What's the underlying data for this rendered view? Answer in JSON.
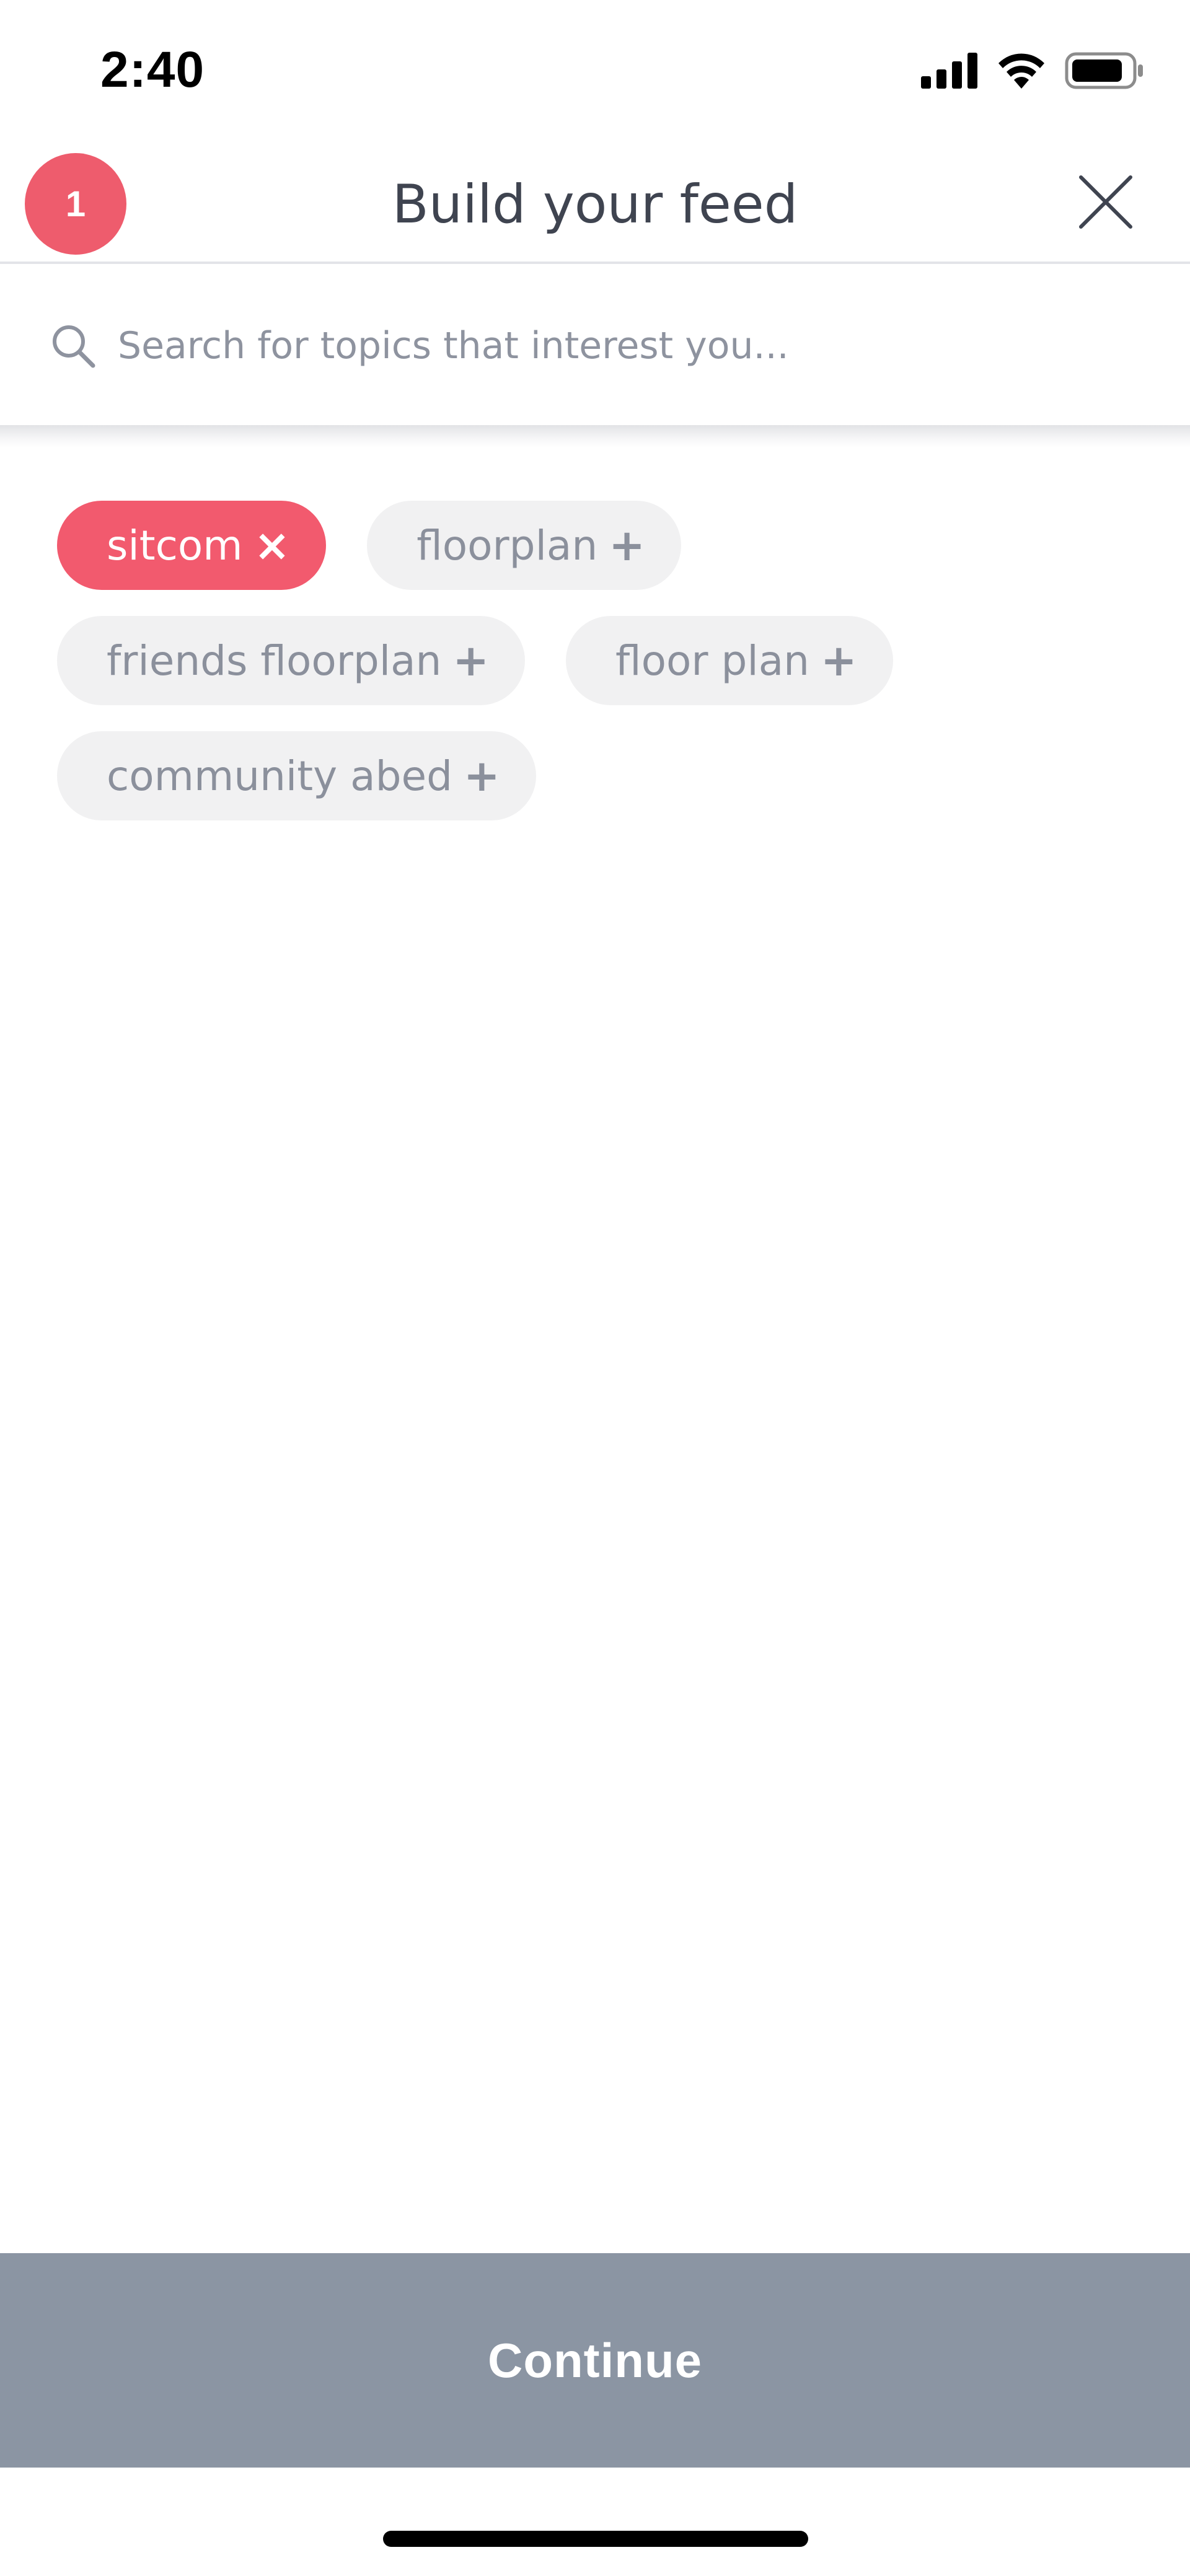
{
  "status_bar": {
    "time": "2:40",
    "icons": [
      "cellular-signal-icon",
      "wifi-icon",
      "battery-icon"
    ]
  },
  "header": {
    "step_badge": "1",
    "title": "Build your feed",
    "close_icon": "close-icon"
  },
  "search": {
    "placeholder": "Search for topics that interest you...",
    "icon": "search-icon"
  },
  "topics": [
    {
      "label": "sitcom",
      "mark": "×",
      "selected": true
    },
    {
      "label": "floorplan",
      "mark": "+",
      "selected": false
    },
    {
      "label": "friends floorplan",
      "mark": "+",
      "selected": false
    },
    {
      "label": "floor plan",
      "mark": "+",
      "selected": false
    },
    {
      "label": "community abed",
      "mark": "+",
      "selected": false
    }
  ],
  "footer": {
    "continue_label": "Continue"
  },
  "colors": {
    "accent": "#f25a6e",
    "badge": "#ee5c6d",
    "chip_bg": "#f1f1f2",
    "chip_text": "#8b909c",
    "continue_bg": "#8b95a3"
  }
}
